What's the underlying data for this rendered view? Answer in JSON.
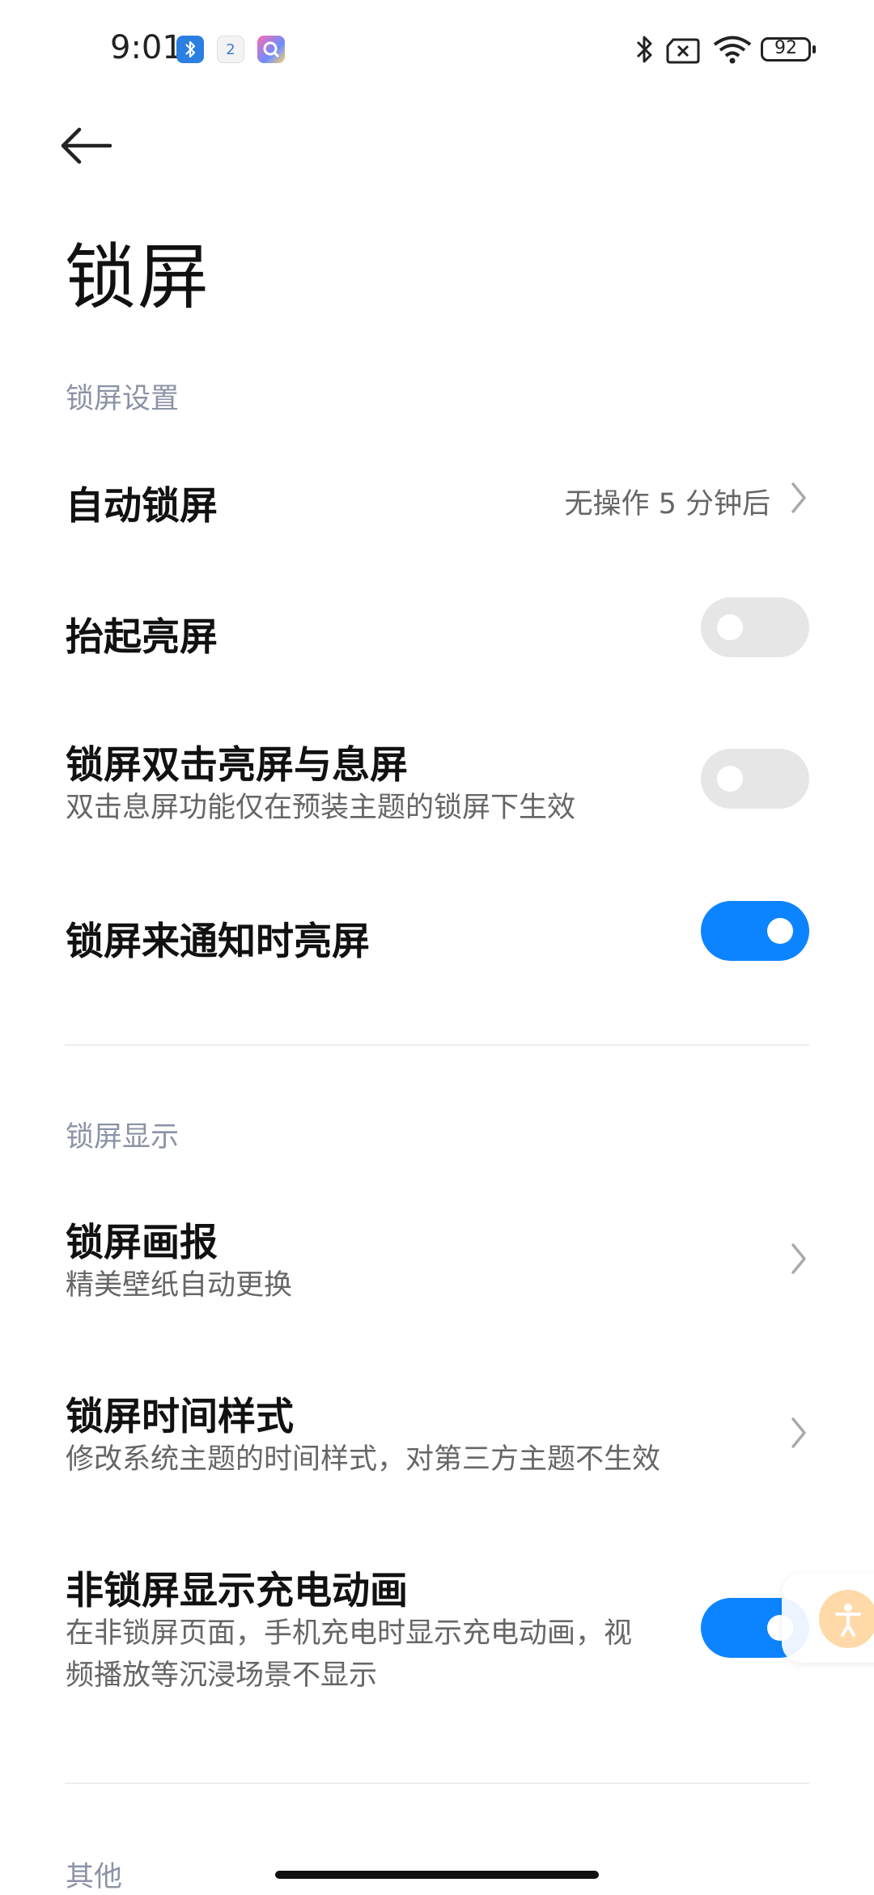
{
  "status_bar": {
    "time": "9:01",
    "calendar_day": "2",
    "battery": "92"
  },
  "page": {
    "title": "锁屏"
  },
  "sections": {
    "lock_settings": {
      "header": "锁屏设置",
      "auto_lock": {
        "title": "自动锁屏",
        "value": "无操作 5 分钟后"
      },
      "raise_to_wake": {
        "title": "抬起亮屏",
        "enabled": false
      },
      "double_tap": {
        "title": "锁屏双击亮屏与息屏",
        "subtitle": "双击息屏功能仅在预装主题的锁屏下生效",
        "enabled": false
      },
      "notify_wake": {
        "title": "锁屏来通知时亮屏",
        "enabled": true
      }
    },
    "lock_display": {
      "header": "锁屏显示",
      "wallpaper_carousel": {
        "title": "锁屏画报",
        "subtitle": "精美壁纸自动更换"
      },
      "clock_style": {
        "title": "锁屏时间样式",
        "subtitle": "修改系统主题的时间样式，对第三方主题不生效"
      },
      "charging_animation": {
        "title": "非锁屏显示充电动画",
        "subtitle_line1": "在非锁屏页面，手机充电时显示充电动画，视",
        "subtitle_line2": "频播放等沉浸场景不显示",
        "enabled": true
      }
    },
    "other": {
      "header": "其他"
    }
  },
  "colors": {
    "accent": "#0d84ff",
    "section_header": "#8c93a6",
    "toggle_off": "#e6e6e6"
  }
}
